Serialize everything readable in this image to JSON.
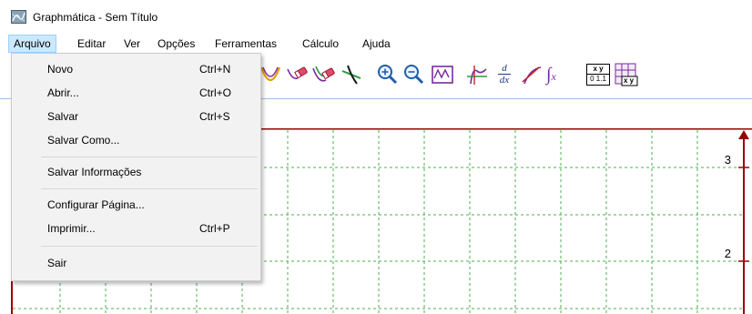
{
  "window": {
    "title": "Graphmática - Sem Título"
  },
  "menubar": {
    "items": [
      {
        "label": "Arquivo"
      },
      {
        "label": "Editar"
      },
      {
        "label": "Ver"
      },
      {
        "label": "Opções"
      },
      {
        "label": "Ferramentas"
      },
      {
        "label": "Cálculo"
      },
      {
        "label": "Ajuda"
      }
    ]
  },
  "file_menu": {
    "items": [
      {
        "label": "Novo",
        "shortcut": "Ctrl+N"
      },
      {
        "label": "Abrir...",
        "shortcut": "Ctrl+O"
      },
      {
        "label": "Salvar",
        "shortcut": "Ctrl+S"
      },
      {
        "label": "Salvar Como...",
        "shortcut": ""
      },
      {
        "label": "Salvar Informações",
        "shortcut": ""
      },
      {
        "label": "Configurar Página...",
        "shortcut": ""
      },
      {
        "label": "Imprimir...",
        "shortcut": "Ctrl+P"
      },
      {
        "label": "Sair",
        "shortcut": ""
      }
    ]
  },
  "toolbar": {
    "icons": [
      "parabola-icon",
      "curve-eraser-icon",
      "multi-curve-eraser-icon",
      "intersection-icon",
      "zoom-in-icon",
      "zoom-out-icon",
      "zoom-fit-icon",
      "tangent-icon",
      "derivative-icon",
      "slope-line-icon",
      "integral-icon",
      "data-table-icon",
      "grid-table-icon"
    ],
    "derivative_top": "d",
    "derivative_bottom": "dx",
    "integral_var": "x",
    "table_header": "x y",
    "table_values": "0 1.1",
    "grid_table_label": "x y"
  },
  "graph": {
    "y_tick_labels": [
      "3",
      "2"
    ],
    "grid_color": "#4caf50",
    "axis_color": "#9b0000"
  }
}
